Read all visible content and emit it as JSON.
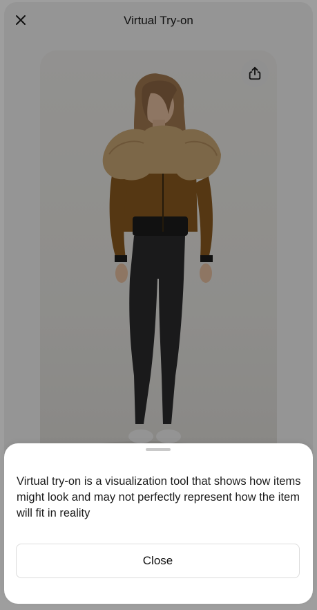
{
  "header": {
    "title": "Virtual Try-on",
    "close_icon": "close-icon"
  },
  "photo": {
    "share_icon": "share-icon",
    "description_icon": "model-photo"
  },
  "sheet": {
    "message": "Virtual try-on is a visualization tool that shows how items might look and may not perfectly represent how the item will fit in reality",
    "close_label": "Close"
  },
  "colors": {
    "overlay": "rgba(0,0,0,0.38)",
    "jacket": "#8a5a1f",
    "leggings": "#2a2a2c",
    "fur": "#c8a675"
  }
}
